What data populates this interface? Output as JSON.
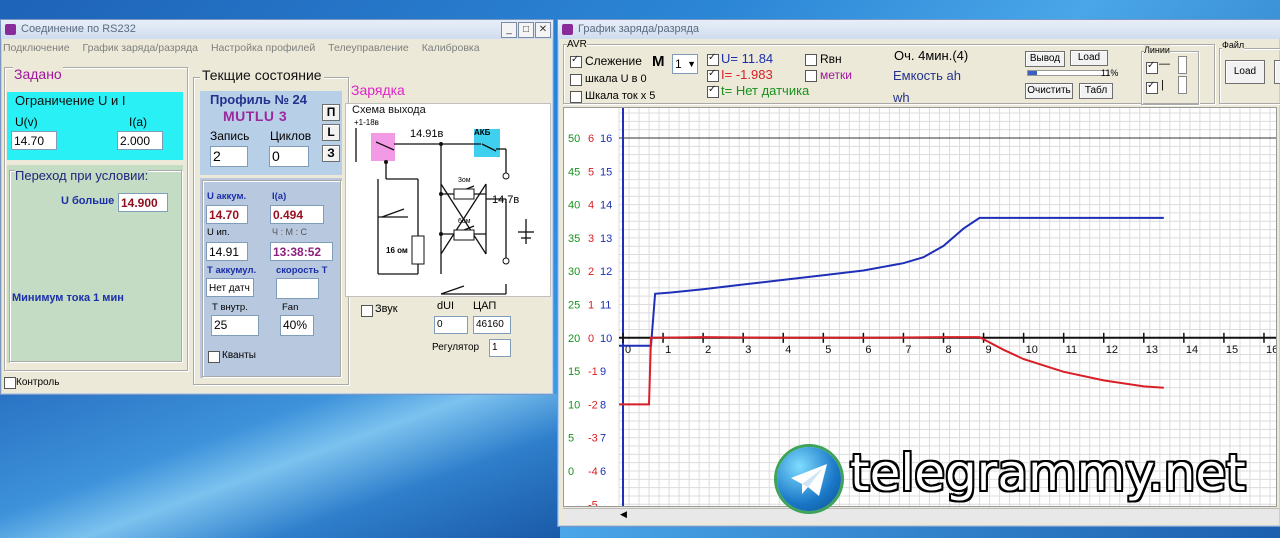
{
  "win1": {
    "title": "Соединение по RS232",
    "menu": [
      "Подключение",
      "График заряда/разряда",
      "Настройка профилей",
      "Телеуправление",
      "Калибровка"
    ],
    "zadano_title": "Задано",
    "limit_title": "Ограничение U и I",
    "u_label": "U(v)",
    "i_label": "I(a)",
    "u_value": "14.70",
    "i_value": "2.000",
    "transition_title": "Переход при условии:",
    "u_more_label": "U больше",
    "u_more_value": "14.900",
    "min_current": "Минимум тока 1 мин",
    "control_label": "Контроль",
    "current_state_title": "Текщие состояние",
    "profile_title": "Профиль № 24",
    "profile_name": "MUTLU 3",
    "btn_p": "П",
    "btn_l": "L",
    "btn_z": "З",
    "record_label": "Запись",
    "cycles_label": "Циклов",
    "record_value": "2",
    "cycles_value": "0",
    "u_akk_label": "U аккум.",
    "i_label2": "I(a)",
    "u_akk_value": "14.70",
    "i_value2": "0.494",
    "u_ip_label": "U ип.",
    "hms_label": "Ч : М : С",
    "u_ip_value": "14.91",
    "time_value": "13:38:52",
    "t_akk_label": "Т аккумул.",
    "speed_label": "скорость Т",
    "t_akk_value": "Нет датч",
    "speed_value": "",
    "t_in_label": "Т внутр.",
    "fan_label": "Fan",
    "t_in_value": "25",
    "fan_value": "40%",
    "kvanty_label": "Кванты",
    "charge_title": "Зарядка",
    "scheme_title": "Схема выхода",
    "scheme_v1": "+1-18в",
    "scheme_v2": "14.91в",
    "scheme_akb": "АКБ",
    "scheme_v3": "14.7в",
    "scheme_r1": "16 ом",
    "scheme_r2": "3ом",
    "scheme_r3": "6ом",
    "zvuk_label": "Звук",
    "dui_label": "dUI",
    "dac_label": "ЦАП",
    "dui_value": "0",
    "dac_value": "46160",
    "regulator_label": "Регулятор",
    "regulator_value": "1"
  },
  "win2": {
    "title": "График заряда/разряда",
    "avr_label": "AVR",
    "follow_label": "Слежение",
    "scale_u_label": "шкала U  в 0",
    "scale_i_label": "Шкала ток x 5",
    "m_label": "M",
    "m_value": "1",
    "u_readout": "U= 11.84",
    "i_readout": "I= -1.983",
    "t_readout": "t= Нет датчика",
    "rvn_label": "Rвн",
    "marks_label": "метки",
    "charge_info": "Оч. 4мин.(4)",
    "capacity_ah": "Емкость ah",
    "wh_label": "wh",
    "btn_output": "Вывод",
    "btn_load": "Load",
    "btn_clear": "Очистить",
    "btn_table": "Табл",
    "progress_pct": "11%",
    "progress_value": 11,
    "lines_label": "Линии",
    "file_label": "Файл",
    "file_load": "Load"
  },
  "chart_data": {
    "type": "line",
    "x_ticks": [
      0,
      1,
      2,
      3,
      4,
      5,
      6,
      7,
      8,
      9,
      10,
      11,
      12,
      13,
      14,
      15,
      16
    ],
    "y_labels": [
      {
        "u": "50",
        "i": "6",
        "t": "16"
      },
      {
        "u": "45",
        "i": "5",
        "t": "15"
      },
      {
        "u": "40",
        "i": "4",
        "t": "14"
      },
      {
        "u": "35",
        "i": "3",
        "t": "13"
      },
      {
        "u": "30",
        "i": "2",
        "t": "12"
      },
      {
        "u": "25",
        "i": "1",
        "t": "11"
      },
      {
        "u": "20",
        "i": "0",
        "t": "10"
      },
      {
        "u": "15",
        "i": "-1",
        "t": "9"
      },
      {
        "u": "10",
        "i": "-2",
        "t": "8"
      },
      {
        "u": "5",
        "i": "-3",
        "t": "7"
      },
      {
        "u": "0",
        "i": "-4",
        "t": "6"
      },
      {
        "u": "",
        "i": "-5",
        "t": ""
      }
    ],
    "xlim": [
      -0.1,
      16.3
    ],
    "ylim": [
      0,
      50
    ],
    "series": [
      {
        "color": "#1f2fb8",
        "values": [
          [
            -0.1,
            18.8
          ],
          [
            0.7,
            18.8
          ],
          [
            0.8,
            26.6
          ],
          [
            1.2,
            26.8
          ],
          [
            2,
            27.3
          ],
          [
            3,
            28.0
          ],
          [
            4,
            28.7
          ],
          [
            5,
            29.4
          ],
          [
            6,
            30.1
          ],
          [
            7,
            31.2
          ],
          [
            7.5,
            32.1
          ],
          [
            8,
            33.8
          ],
          [
            8.5,
            36.4
          ],
          [
            8.9,
            38.0
          ],
          [
            13.5,
            38.0
          ]
        ]
      },
      {
        "color": "#d81f26",
        "values": [
          [
            -0.1,
            10.0
          ],
          [
            0.65,
            10.0
          ],
          [
            0.7,
            20.0
          ],
          [
            2,
            20.1
          ],
          [
            4,
            20.0
          ],
          [
            6,
            20.0
          ],
          [
            8,
            20.1
          ],
          [
            8.9,
            20.1
          ],
          [
            9.5,
            18.2
          ],
          [
            10,
            16.8
          ],
          [
            11,
            14.9
          ],
          [
            12,
            13.6
          ],
          [
            13,
            12.7
          ],
          [
            13.5,
            12.5
          ]
        ]
      }
    ]
  },
  "watermark": "telegrammy.net"
}
